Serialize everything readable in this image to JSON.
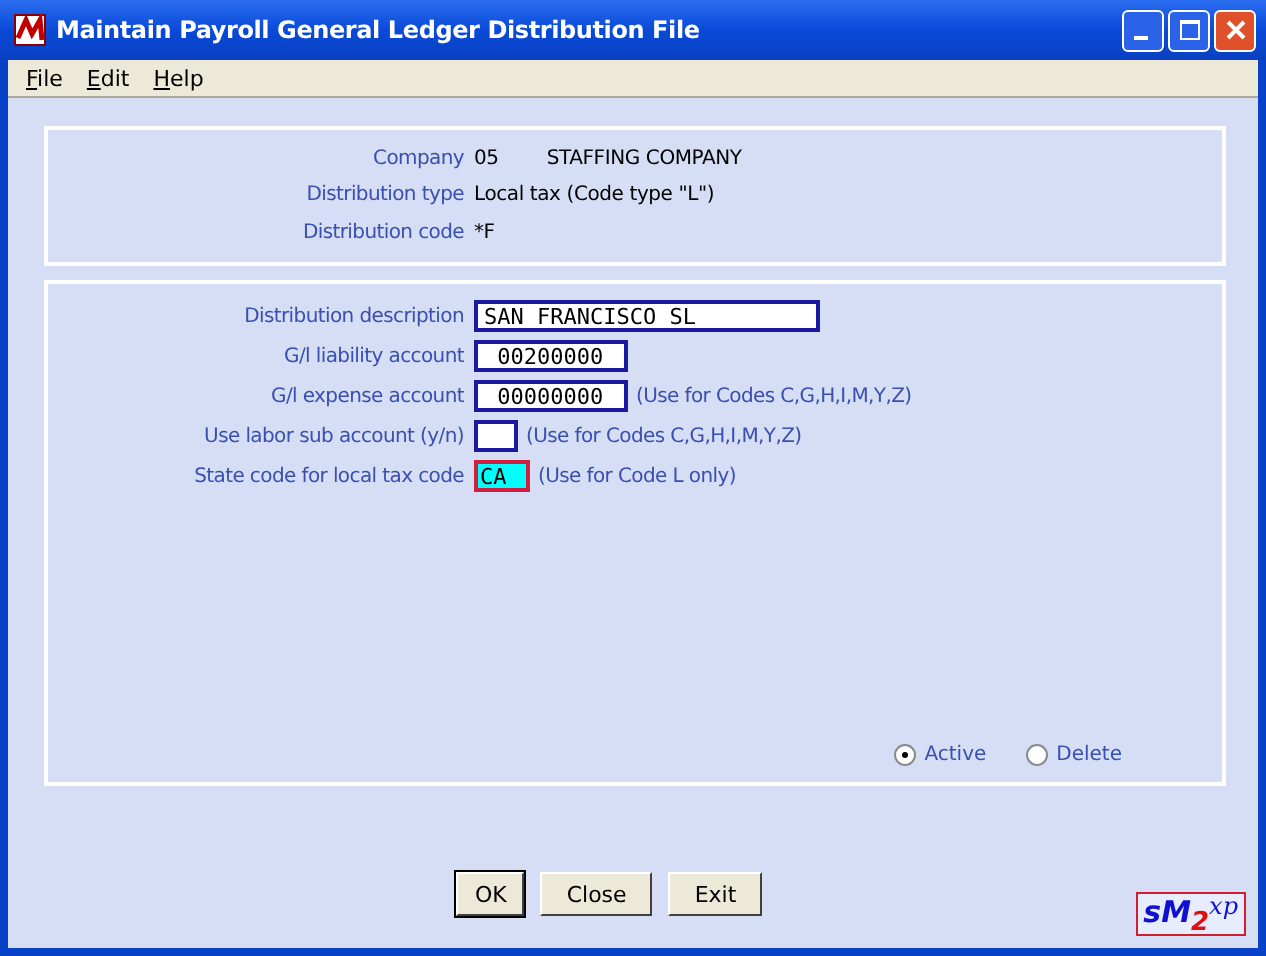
{
  "window": {
    "title": "Maintain Payroll General Ledger Distribution File"
  },
  "menu": [
    "File",
    "Edit",
    "Help"
  ],
  "header": [
    {
      "label": "Company",
      "values": [
        "05",
        "STAFFING COMPANY"
      ]
    },
    {
      "label": "Distribution type",
      "values": [
        "Local tax (Code type \"L\")"
      ]
    },
    {
      "label": "Distribution code",
      "values": [
        "*F"
      ]
    }
  ],
  "fields": [
    {
      "label": "Distribution description",
      "value": "SAN FRANCISCO SL",
      "kind": "wide"
    },
    {
      "label": "G/l liability account",
      "value": " 00200000",
      "kind": "account"
    },
    {
      "label": "G/l expense account",
      "value": " 00000000",
      "kind": "account",
      "note": "(Use for Codes C,G,H,I,M,Y,Z)"
    },
    {
      "label": "Use labor sub account (y/n)",
      "kind": "flag",
      "note": "(Use for Codes C,G,H,I,M,Y,Z)"
    },
    {
      "label": "State code for local tax code",
      "value": "CA",
      "kind": "flag",
      "focused": true,
      "note": "(Use for Code L only)"
    }
  ],
  "status_options": [
    {
      "label": "Active",
      "selected": true
    },
    {
      "label": "Delete",
      "selected": false
    }
  ],
  "buttons": [
    "OK",
    "Close",
    "Exit"
  ],
  "logo": [
    {
      "text": "s",
      "color": "#1010d0"
    },
    {
      "text": "M",
      "color": "#1010d0"
    },
    {
      "text": "2",
      "color": "#e01010"
    },
    {
      "text": "xp",
      "color": "#1010d0"
    }
  ]
}
